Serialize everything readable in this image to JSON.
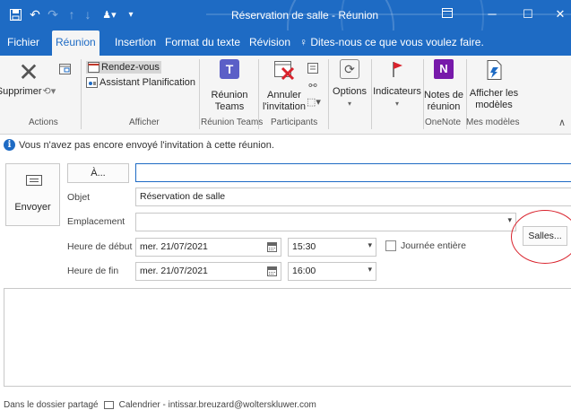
{
  "window": {
    "title": "Réservation de salle - Réunion"
  },
  "tabs": [
    {
      "label": "Fichier"
    },
    {
      "label": "Réunion"
    },
    {
      "label": "Insertion"
    },
    {
      "label": "Format du texte"
    },
    {
      "label": "Révision"
    },
    {
      "label": "Dites-nous ce que vous voulez faire."
    }
  ],
  "ribbon": {
    "delete_label": "Supprimer",
    "appointment_label": "Rendez-vous",
    "scheduling_label": "Assistant Planification",
    "teams_line1": "Réunion",
    "teams_line2": "Teams",
    "cancel_line1": "Annuler",
    "cancel_line2": "l'invitation",
    "options_label": "Options",
    "indicators_label": "Indicateurs",
    "notes_line1": "Notes de",
    "notes_line2": "réunion",
    "templates_line1": "Afficher les",
    "templates_line2": "modèles",
    "groups": {
      "actions": "Actions",
      "afficher": "Afficher",
      "teams": "Réunion Teams",
      "participants": "Participants",
      "onenote": "OneNote",
      "templates": "Mes modèles"
    }
  },
  "info": {
    "message": "Vous n'avez pas encore envoyé l'invitation à cette réunion."
  },
  "form": {
    "send_label": "Envoyer",
    "to_label": "À...",
    "to_value": "",
    "subject_label": "Objet",
    "subject_value": "Réservation de salle",
    "location_label": "Emplacement",
    "location_value": "",
    "rooms_label": "Salles...",
    "start_label": "Heure de début",
    "start_date": "mer. 21/07/2021",
    "start_time": "15:30",
    "allday_label": "Journée entière",
    "end_label": "Heure de fin",
    "end_date": "mer. 21/07/2021",
    "end_time": "16:00"
  },
  "status": {
    "folder_label": "Dans le dossier partagé",
    "calendar_label": "Calendrier - intissar.breuzard@wolterskluwer.com"
  },
  "colors": {
    "accent": "#1e6bc4",
    "highlight_circle": "#d9232d"
  }
}
